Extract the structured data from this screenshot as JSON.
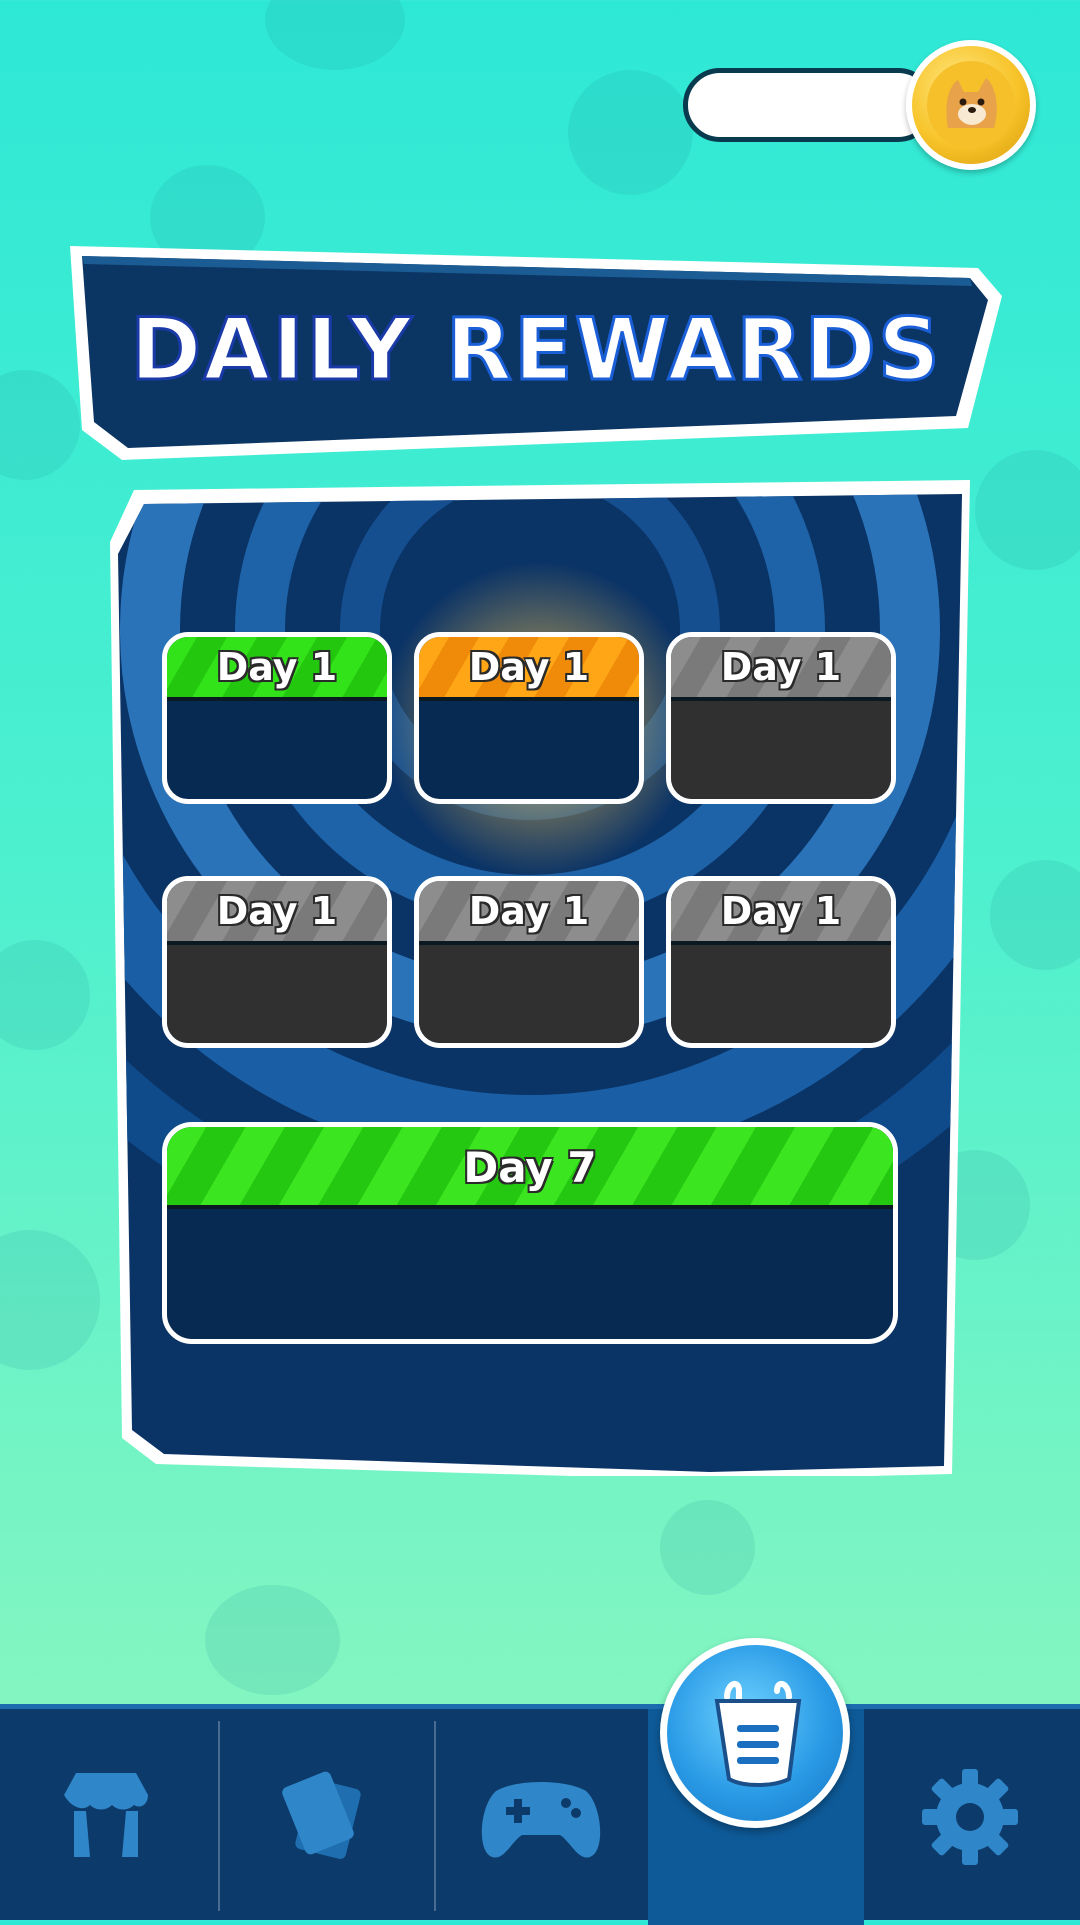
{
  "header": {
    "coin_value": ""
  },
  "title": {
    "word1": "DAILY",
    "word2": "REWARDS"
  },
  "rewards": {
    "days": [
      {
        "label": "Day 1",
        "state": "claimed",
        "color": "#2fd81a"
      },
      {
        "label": "Day 1",
        "state": "current",
        "color": "#f79a10"
      },
      {
        "label": "Day 1",
        "state": "locked",
        "color": "#888888"
      },
      {
        "label": "Day 1",
        "state": "locked",
        "color": "#888888"
      },
      {
        "label": "Day 1",
        "state": "locked",
        "color": "#888888"
      },
      {
        "label": "Day 1",
        "state": "locked",
        "color": "#888888"
      }
    ],
    "final": {
      "label": "Day 7",
      "color": "#2fd81a"
    }
  },
  "nav": {
    "items": [
      {
        "name": "shop",
        "icon": "shop-awning-icon"
      },
      {
        "name": "cards",
        "icon": "cards-icon"
      },
      {
        "name": "play",
        "icon": "gamepad-icon"
      },
      {
        "name": "store",
        "icon": "shopping-bag-icon",
        "active": true
      },
      {
        "name": "settings",
        "icon": "gear-icon"
      }
    ]
  },
  "colors": {
    "accent": "#0c3a6a",
    "board": "#0a3366",
    "background": "#3feccf"
  }
}
